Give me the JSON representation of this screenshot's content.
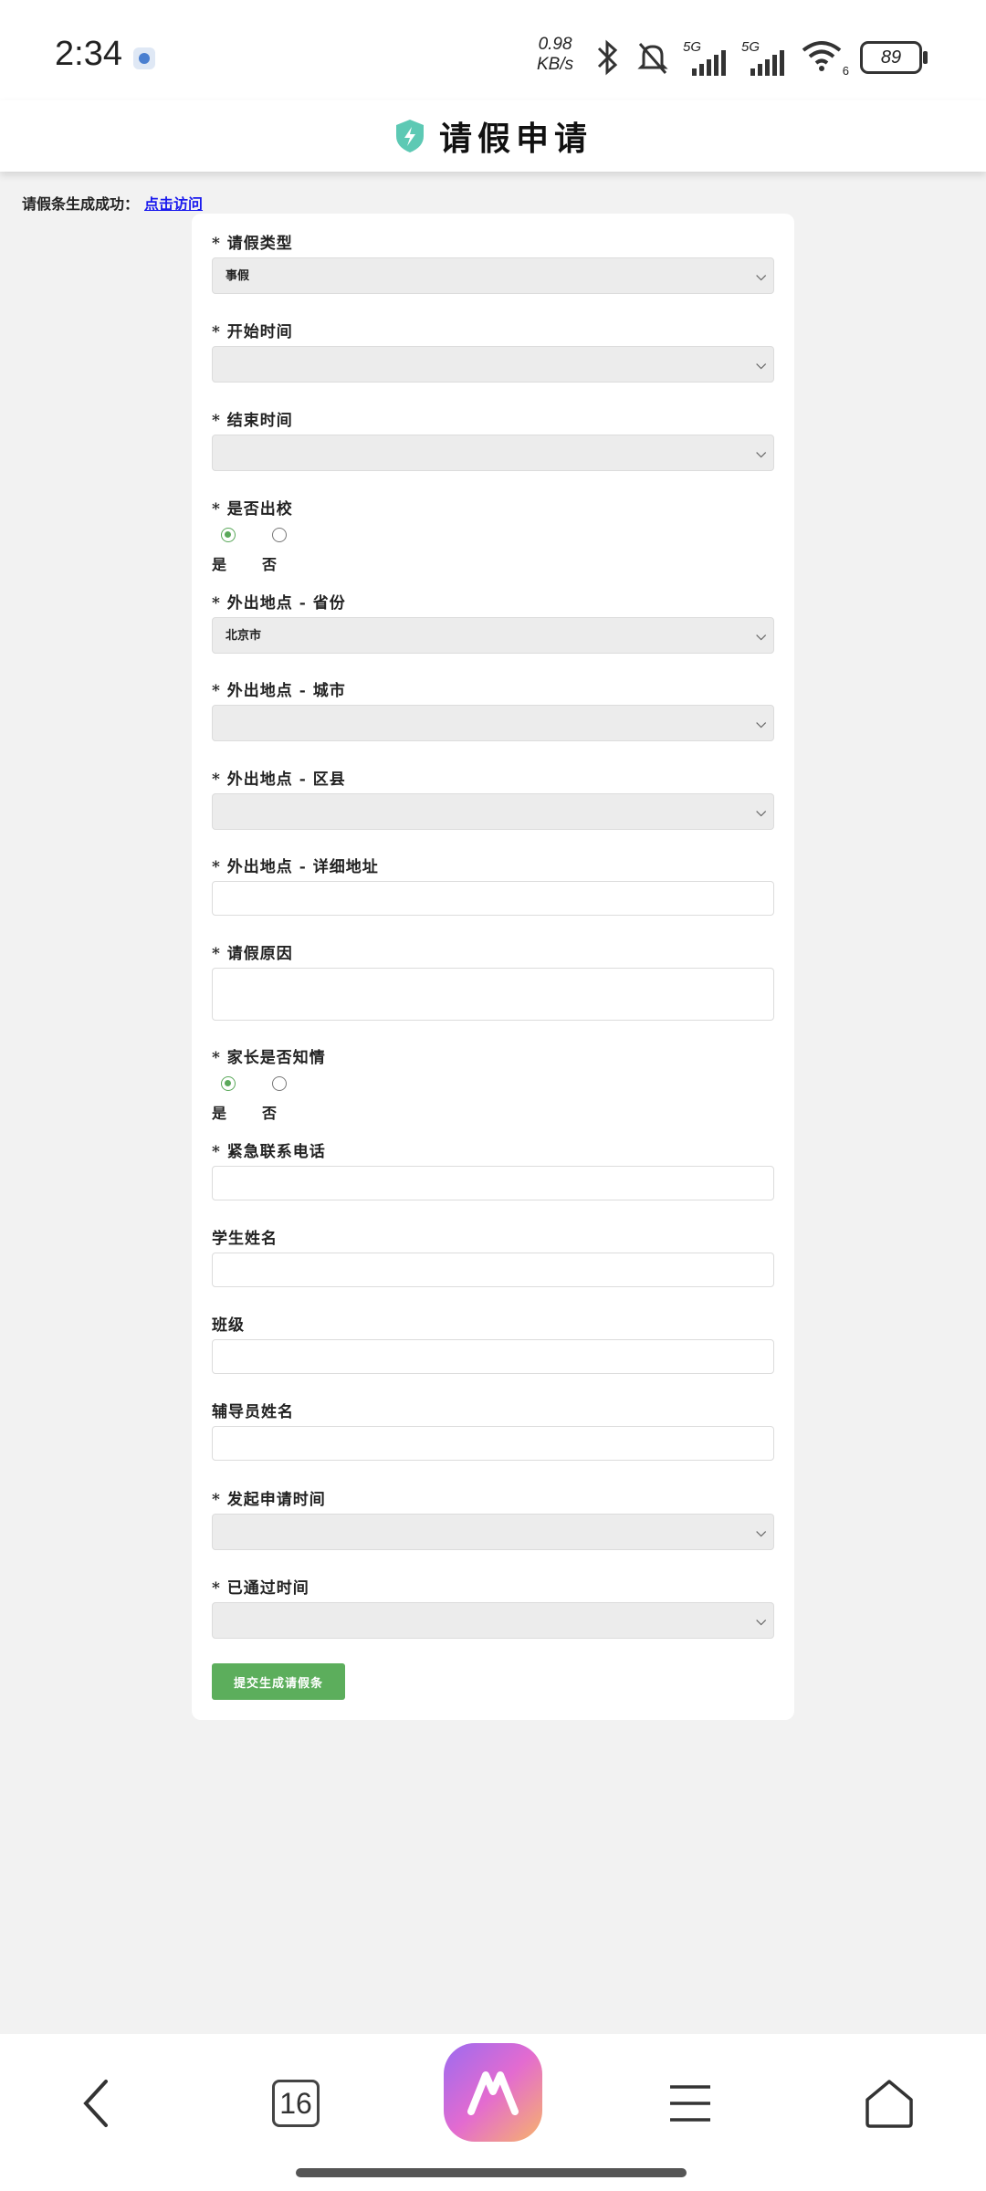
{
  "status_bar": {
    "time": "2:34",
    "net_speed_value": "0.98",
    "net_speed_unit": "KB/s",
    "signal_1": "5G",
    "signal_2": "5G",
    "wifi_sub": "6",
    "battery": "89"
  },
  "header": {
    "title": "请假申请"
  },
  "success": {
    "text": "请假条生成成功：",
    "link": "点击访问"
  },
  "form": {
    "leave_type": {
      "label": "* 请假类型",
      "value": "事假"
    },
    "start_time": {
      "label": "* 开始时间",
      "value": ""
    },
    "end_time": {
      "label": "* 结束时间",
      "value": ""
    },
    "leave_school": {
      "label": "* 是否出校",
      "yes": "是",
      "no": "否",
      "selected": "是"
    },
    "province": {
      "label": "* 外出地点 - 省份",
      "value": "北京市"
    },
    "city": {
      "label": "* 外出地点 - 城市",
      "value": ""
    },
    "district": {
      "label": "* 外出地点 - 区县",
      "value": ""
    },
    "address": {
      "label": "* 外出地点 - 详细地址",
      "value": ""
    },
    "reason": {
      "label": "* 请假原因",
      "value": ""
    },
    "parent_aware": {
      "label": "* 家长是否知情",
      "yes": "是",
      "no": "否",
      "selected": "是"
    },
    "emergency_phone": {
      "label": "* 紧急联系电话",
      "value": ""
    },
    "student_name": {
      "label": "学生姓名",
      "value": ""
    },
    "class": {
      "label": "班级",
      "value": ""
    },
    "counselor": {
      "label": "辅导员姓名",
      "value": ""
    },
    "apply_time": {
      "label": "* 发起申请时间",
      "value": ""
    },
    "approved_time": {
      "label": "* 已通过时间",
      "value": ""
    },
    "submit_label": "提交生成请假条"
  },
  "bottom_nav": {
    "tabs_count": "16"
  },
  "colors": {
    "accent_green": "#5cae5c",
    "link_blue": "#1a1aee",
    "shield": "#5dc9b4"
  }
}
